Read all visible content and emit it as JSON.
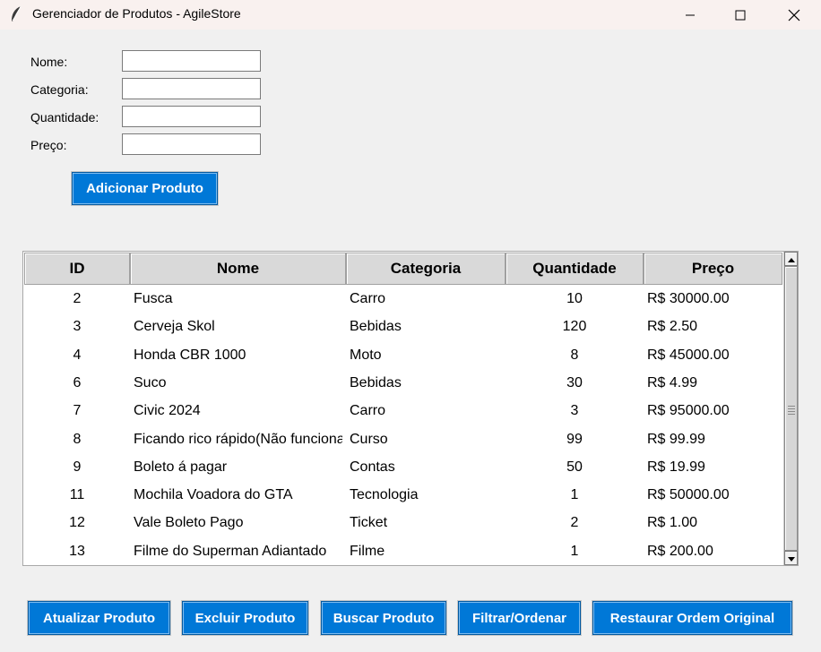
{
  "window": {
    "title": "Gerenciador de Produtos - AgileStore",
    "icon": "feather-icon",
    "controls": [
      "minimize-icon",
      "maximize-icon",
      "close-icon"
    ]
  },
  "form": {
    "nome_label": "Nome:",
    "nome_value": "",
    "categoria_label": "Categoria:",
    "categoria_value": "",
    "quantidade_label": "Quantidade:",
    "quantidade_value": "",
    "preco_label": "Preço:",
    "preco_value": "",
    "add_button": "Adicionar Produto"
  },
  "table": {
    "columns": [
      "ID",
      "Nome",
      "Categoria",
      "Quantidade",
      "Preço"
    ],
    "rows": [
      {
        "id": "2",
        "nome": "Fusca",
        "categoria": "Carro",
        "quantidade": "10",
        "preco": "R$ 30000.00"
      },
      {
        "id": "3",
        "nome": "Cerveja Skol",
        "categoria": "Bebidas",
        "quantidade": "120",
        "preco": "R$ 2.50"
      },
      {
        "id": "4",
        "nome": "Honda CBR 1000",
        "categoria": "Moto",
        "quantidade": "8",
        "preco": "R$ 45000.00"
      },
      {
        "id": "6",
        "nome": "Suco",
        "categoria": "Bebidas",
        "quantidade": "30",
        "preco": "R$ 4.99"
      },
      {
        "id": "7",
        "nome": "Civic 2024",
        "categoria": "Carro",
        "quantidade": "3",
        "preco": "R$ 95000.00"
      },
      {
        "id": "8",
        "nome": "Ficando rico rápido(Não funciona",
        "categoria": "Curso",
        "quantidade": "99",
        "preco": "R$ 99.99"
      },
      {
        "id": "9",
        "nome": "Boleto á pagar",
        "categoria": "Contas",
        "quantidade": "50",
        "preco": "R$ 19.99"
      },
      {
        "id": "11",
        "nome": "Mochila Voadora do GTA",
        "categoria": "Tecnologia",
        "quantidade": "1",
        "preco": "R$ 50000.00"
      },
      {
        "id": "12",
        "nome": "Vale Boleto Pago",
        "categoria": "Ticket",
        "quantidade": "2",
        "preco": "R$ 1.00"
      },
      {
        "id": "13",
        "nome": "Filme do Superman Adiantado",
        "categoria": "Filme",
        "quantidade": "1",
        "preco": "R$ 200.00"
      }
    ]
  },
  "actions": {
    "atualizar": "Atualizar Produto",
    "excluir": "Excluir Produto",
    "buscar": "Buscar Produto",
    "filtrar": "Filtrar/Ordenar",
    "restaurar": "Restaurar Ordem Original"
  },
  "colors": {
    "button_bg": "#0078d7",
    "button_text": "#ffffff",
    "window_bg": "#f0f0f0",
    "titlebar_bg": "#f9f1ef"
  }
}
